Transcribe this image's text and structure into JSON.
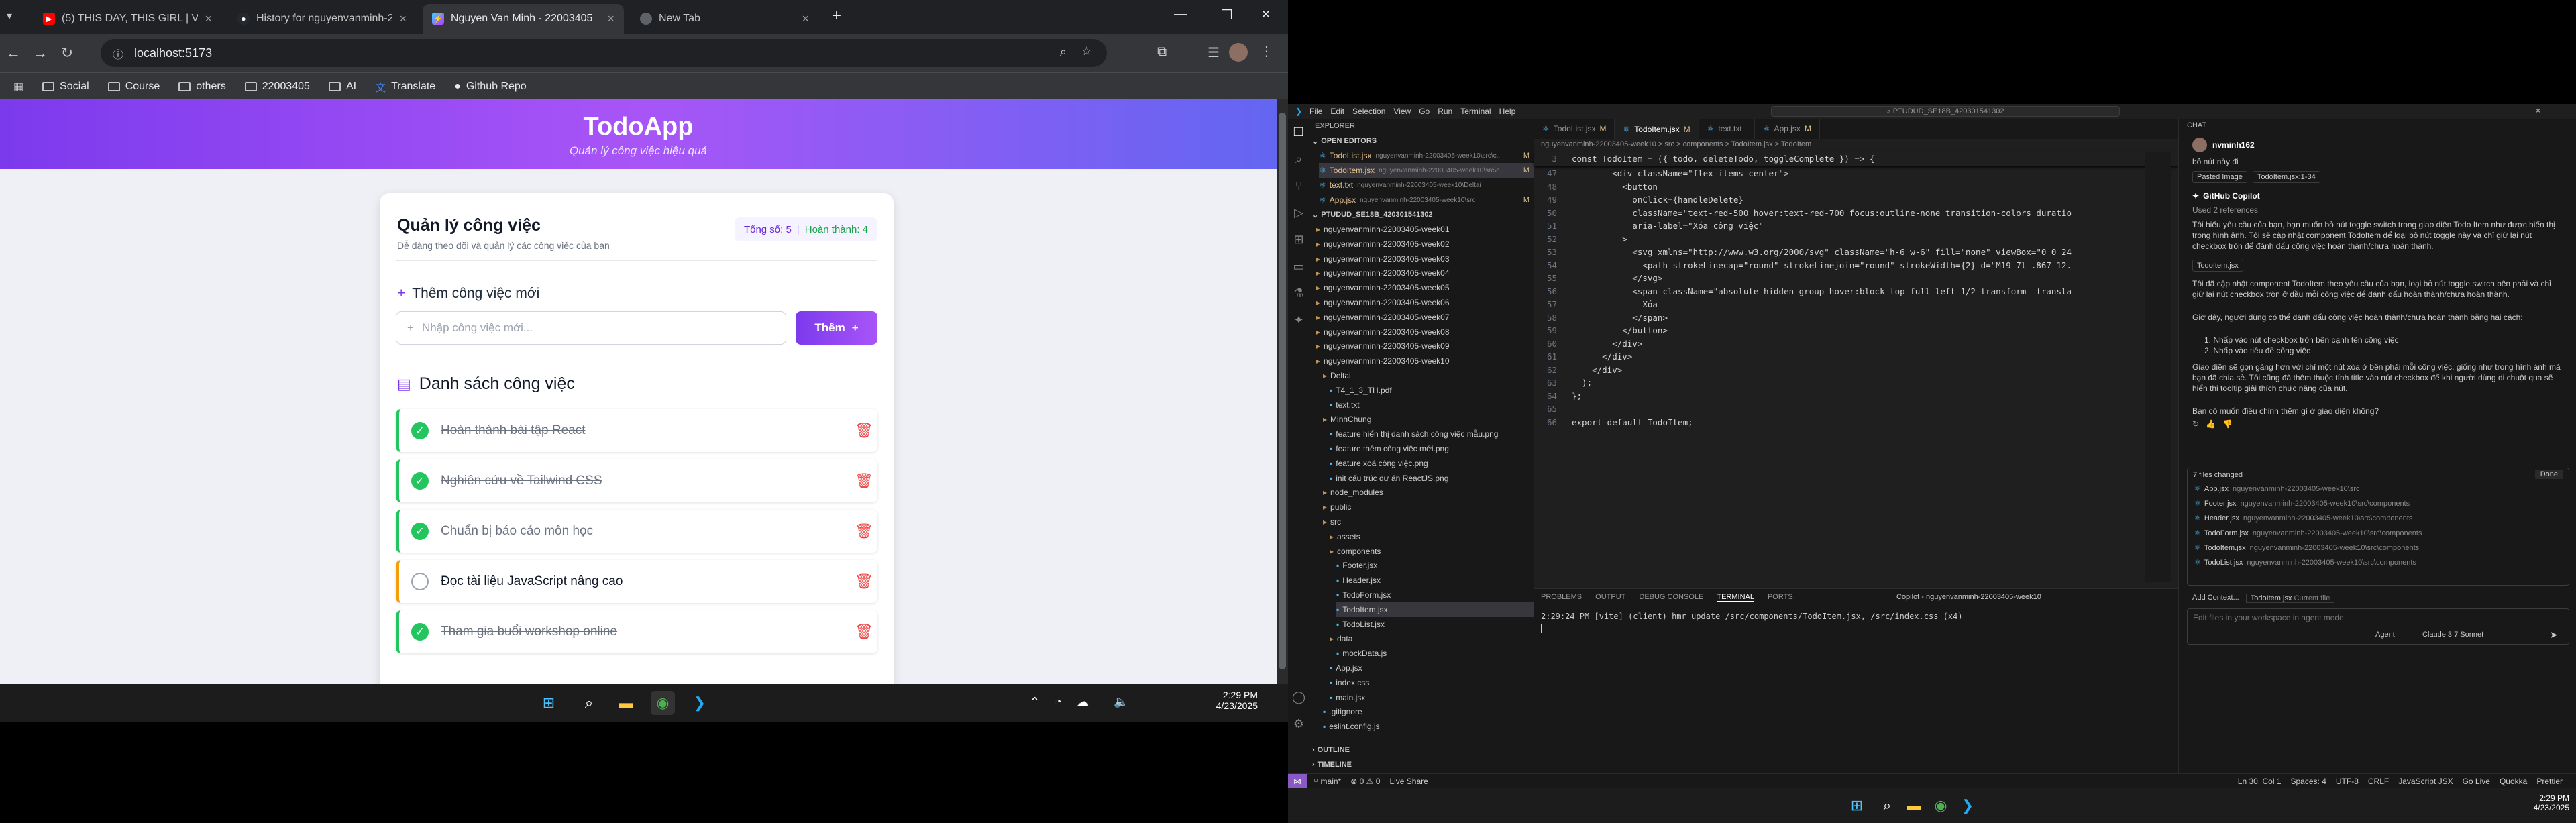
{
  "browser": {
    "tabs": [
      {
        "title": "(5) THIS DAY, THIS GIRL | Vl",
        "icon": "youtube-icon",
        "color": "#ff0000"
      },
      {
        "title": "History for nguyenvanminh-22",
        "icon": "github-icon",
        "color": "#ffffff"
      },
      {
        "title": "Nguyen Van Minh - 22003405",
        "icon": "vite-icon",
        "color": "#a855f7"
      },
      {
        "title": "New Tab",
        "icon": "chrome-icon",
        "color": "#9aa0a6"
      }
    ],
    "new_tab": "+",
    "url": "localhost:5173",
    "bookmarks": [
      "Social",
      "Course",
      "others",
      "22003405",
      "AI",
      "Translate",
      "Github Repo"
    ]
  },
  "app": {
    "title": "TodoApp",
    "subtitle": "Quản lý công việc hiệu quả",
    "card_title": "Quản lý công việc",
    "card_subtitle": "Dễ dàng theo dõi và quản lý các công việc của bạn",
    "total_label": "Tổng số: 5",
    "done_label": "Hoàn thành: 4",
    "add_heading": "Thêm công việc mới",
    "input_placeholder": "Nhập công việc mới...",
    "add_button": "Thêm",
    "list_heading": "Danh sách công việc",
    "todos": [
      {
        "text": "Hoàn thành bài tập React",
        "done": true
      },
      {
        "text": "Nghiên cứu về Tailwind CSS",
        "done": true
      },
      {
        "text": "Chuẩn bị báo cáo môn học",
        "done": true
      },
      {
        "text": "Đọc tài liệu JavaScript nâng cao",
        "done": false
      },
      {
        "text": "Tham gia buổi workshop online",
        "done": true
      }
    ],
    "colors": {
      "accent": "#7c3aed",
      "done": "#22c55e",
      "pending": "#f59e0b",
      "delete": "#ef4444"
    }
  },
  "taskbar_left": {
    "time": "2:29 PM",
    "date": "4/23/2025"
  },
  "taskbar_right": {
    "time": "2:29 PM",
    "date": "4/23/2025"
  },
  "vscode": {
    "menu": [
      "File",
      "Edit",
      "Selection",
      "View",
      "Go",
      "Run",
      "Terminal",
      "Help"
    ],
    "search": "PTUDUD_SE18B_420301541302",
    "explorer_title": "EXPLORER",
    "open_editors": "OPEN EDITORS",
    "open_files": [
      {
        "name": "TodoList.jsx",
        "path": "nguyenvanminh-22003405-week10\\src\\c...",
        "mark": "M"
      },
      {
        "name": "TodoItem.jsx",
        "path": "nguyenvanminh-22003405-week10\\src\\c...",
        "mark": "M"
      },
      {
        "name": "text.txt",
        "path": "nguyenvanminh-22003405-week10\\Deltai",
        "mark": ""
      },
      {
        "name": "App.jsx",
        "path": "nguyenvanminh-22003405-week10\\src",
        "mark": "M"
      }
    ],
    "workspace": "PTUDUD_SE18B_420301541302",
    "tree": [
      "nguyenvanminh-22003405-week01",
      "nguyenvanminh-22003405-week02",
      "nguyenvanminh-22003405-week03",
      "nguyenvanminh-22003405-week04",
      "nguyenvanminh-22003405-week05",
      "nguyenvanminh-22003405-week06",
      "nguyenvanminh-22003405-week07",
      "nguyenvanminh-22003405-week08",
      "nguyenvanminh-22003405-week09",
      "nguyenvanminh-22003405-week10",
      "Deltai",
      "T4_1_3_TH.pdf",
      "text.txt",
      "MinhChung",
      "feature hiển thị danh sách công việc mẫu.png",
      "feature thêm công việc mới.png",
      "feature xoá công việc.png",
      "init cấu trúc dự án ReactJS.png",
      "node_modules",
      "public",
      "src",
      "assets",
      "components",
      "Footer.jsx",
      "Header.jsx",
      "TodoForm.jsx",
      "TodoItem.jsx",
      "TodoList.jsx",
      "data",
      "mockData.js",
      "App.jsx",
      "index.css",
      "main.jsx",
      ".gitignore",
      "eslint.config.js"
    ],
    "outline": "OUTLINE",
    "timeline": "TIMELINE",
    "editor_tabs": [
      {
        "name": "TodoList.jsx",
        "mark": "M"
      },
      {
        "name": "TodoItem.jsx",
        "mark": "M"
      },
      {
        "name": "text.txt",
        "mark": ""
      },
      {
        "name": "App.jsx",
        "mark": "M"
      }
    ],
    "breadcrumb": "nguyenvanminh-22003405-week10 > src > components > TodoItem.jsx > TodoItem",
    "code_header": "const TodoItem = ({ todo, deleteTodo, toggleComplete }) => {",
    "code": [
      {
        "n": "47",
        "t": "        <div className=\"flex items-center\">"
      },
      {
        "n": "48",
        "t": "          <button"
      },
      {
        "n": "49",
        "t": "            onClick={handleDelete}"
      },
      {
        "n": "50",
        "t": "            className=\"text-red-500 hover:text-red-700 focus:outline-none transition-colors duratio"
      },
      {
        "n": "51",
        "t": "            aria-label=\"Xóa công việc\""
      },
      {
        "n": "52",
        "t": "          >"
      },
      {
        "n": "53",
        "t": "            <svg xmlns=\"http://www.w3.org/2000/svg\" className=\"h-6 w-6\" fill=\"none\" viewBox=\"0 0 24"
      },
      {
        "n": "54",
        "t": "              <path strokeLinecap=\"round\" strokeLinejoin=\"round\" strokeWidth={2} d=\"M19 7l-.867 12."
      },
      {
        "n": "55",
        "t": "            </svg>"
      },
      {
        "n": "56",
        "t": "            <span className=\"absolute hidden group-hover:block top-full left-1/2 transform -transla"
      },
      {
        "n": "57",
        "t": "              Xóa"
      },
      {
        "n": "58",
        "t": "            </span>"
      },
      {
        "n": "59",
        "t": "          </button>"
      },
      {
        "n": "60",
        "t": "        </div>"
      },
      {
        "n": "61",
        "t": "      </div>"
      },
      {
        "n": "62",
        "t": "    </div>"
      },
      {
        "n": "63",
        "t": "  );"
      },
      {
        "n": "64",
        "t": "};"
      },
      {
        "n": "65",
        "t": ""
      },
      {
        "n": "66",
        "t": "export default TodoItem;"
      }
    ],
    "panel_tabs": [
      "PROBLEMS",
      "OUTPUT",
      "DEBUG CONSOLE",
      "TERMINAL",
      "PORTS"
    ],
    "terminal_name": "Copilot - nguyenvanminh-22003405-week10",
    "terminal_line": "2:29:24 PM [vite] (client) hmr update /src/components/TodoItem.jsx, /src/index.css (x4)",
    "chat": {
      "title": "CHAT",
      "user": "nvminh162",
      "user_msg": "bỏ nút này đi",
      "attachments": [
        "Pasted Image",
        "TodoItem.jsx:1-34"
      ],
      "bot": "GitHub Copilot",
      "refs": "Used 2 references",
      "p1": "Tôi hiểu yêu cầu của bạn, bạn muốn bỏ nút toggle switch trong giao diện Todo Item như được hiển thị trong hình ảnh. Tôi sẽ cập nhật component TodoItem để loại bỏ nút toggle này và chỉ giữ lại nút checkbox tròn để đánh dấu công việc hoàn thành/chưa hoàn thành.",
      "file_chip": "TodoItem.jsx",
      "p2": "Tôi đã cập nhật component TodoItem theo yêu cầu của bạn, loại bỏ nút toggle switch bên phải và chỉ giữ lại nút checkbox tròn ở đầu mỗi công việc để đánh dấu hoàn thành/chưa hoàn thành.",
      "p3": "Giờ đây, người dùng có thể đánh dấu công việc hoàn thành/chưa hoàn thành bằng hai cách:",
      "li1": "Nhấp vào nút checkbox tròn bên cạnh tên công việc",
      "li2": "Nhấp vào tiêu đề công việc",
      "p4": "Giao diện sẽ gọn gàng hơn với chỉ một nút xóa ở bên phải mỗi công việc, giống như trong hình ảnh mà bạn đã chia sẻ. Tôi cũng đã thêm thuộc tính title vào nút checkbox để khi người dùng di chuột qua sẽ hiển thị tooltip giải thích chức năng của nút.",
      "p5": "Bạn có muốn điều chỉnh thêm gì ở giao diện không?",
      "changed": "7 files changed",
      "done_btn": "Done",
      "files": [
        {
          "name": "App.jsx",
          "path": "nguyenvanminh-22003405-week10\\src"
        },
        {
          "name": "Footer.jsx",
          "path": "nguyenvanminh-22003405-week10\\src\\components"
        },
        {
          "name": "Header.jsx",
          "path": "nguyenvanminh-22003405-week10\\src\\components"
        },
        {
          "name": "TodoForm.jsx",
          "path": "nguyenvanminh-22003405-week10\\src\\components"
        },
        {
          "name": "TodoItem.jsx",
          "path": "nguyenvanminh-22003405-week10\\src\\components"
        },
        {
          "name": "TodoList.jsx",
          "path": "nguyenvanminh-22003405-week10\\src\\components"
        }
      ],
      "add_context": "Add Context...",
      "current_file": "TodoItem.jsx",
      "current_file_label": "Current file",
      "input_placeholder": "Edit files in your workspace in agent mode",
      "mode": "Agent",
      "model": "Claude 3.7 Sonnet"
    },
    "status": {
      "branch": "main*",
      "errors": "0",
      "warnings": "0",
      "live_share": "Live Share",
      "position": "Ln 30, Col 1",
      "spaces": "Spaces: 4",
      "encoding": "UTF-8",
      "eol": "CRLF",
      "lang": "JavaScript JSX",
      "golive": "Go Live",
      "quokka": "Quokka",
      "prettier": "Prettier"
    }
  }
}
